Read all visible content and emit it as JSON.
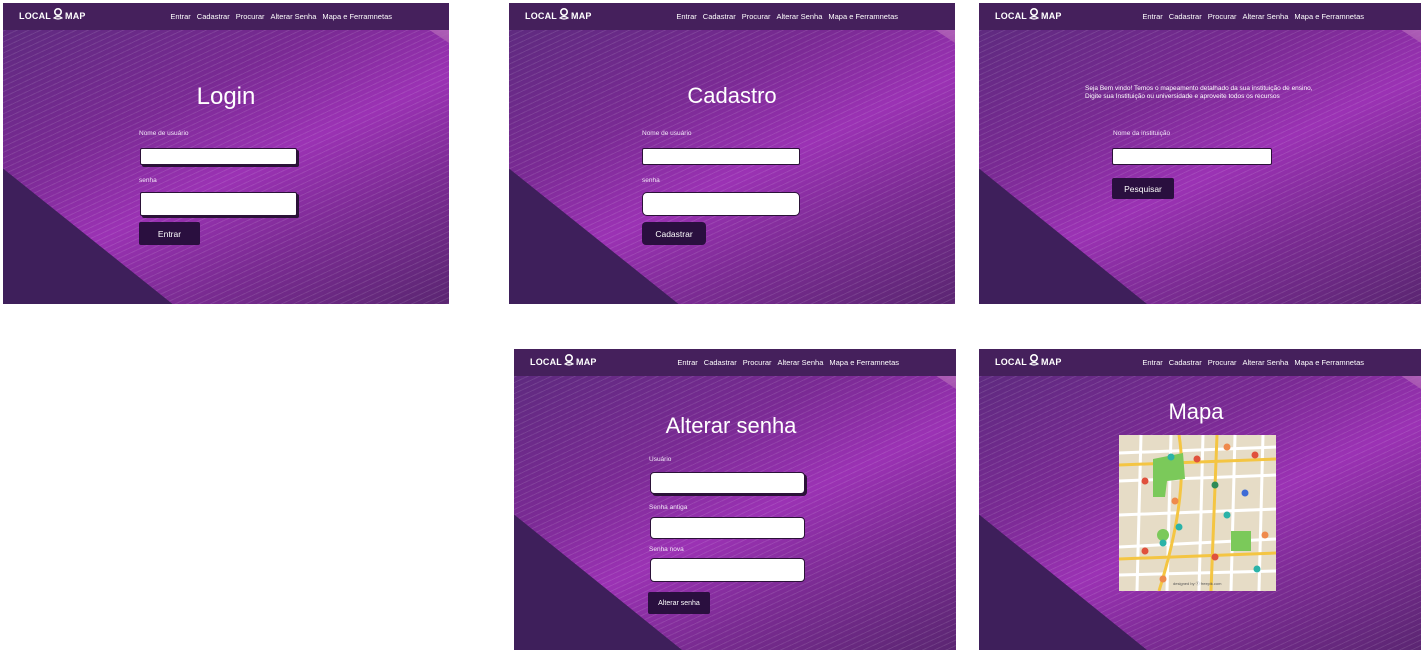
{
  "nav": {
    "logo_left": "LOCAL",
    "logo_right": "MAP",
    "links": [
      "Entrar",
      "Cadastrar",
      "Procurar",
      "Alterar Senha",
      "Mapa e Ferramnetas"
    ]
  },
  "login": {
    "title": "Login",
    "username_label": "Nome de usuário",
    "password_label": "senha",
    "submit": "Entrar"
  },
  "register": {
    "title": "Cadastro",
    "username_label": "Nome de usuário",
    "password_label": "senha",
    "submit": "Cadastrar"
  },
  "search": {
    "welcome_line1": "Seja Bem vindo! Temos o mapeamento detalhado da sua instituição de ensino,",
    "welcome_line2": "Digite sua Instituição ou universidade e aproveite todos os recursos",
    "institution_label": "Nome da instituição",
    "submit": "Pesquisar"
  },
  "change_password": {
    "title": "Alterar senha",
    "user_label": "Usuário",
    "old_label": "Senha antiga",
    "new_label": "Senha nova",
    "submit": "Alterar senha"
  },
  "map_page": {
    "title": "Mapa",
    "credit": "designed by ⓕ freepik.com"
  },
  "colors": {
    "nav": "#45205c",
    "button": "#2a0f3f",
    "accent": "#9b32b4"
  }
}
